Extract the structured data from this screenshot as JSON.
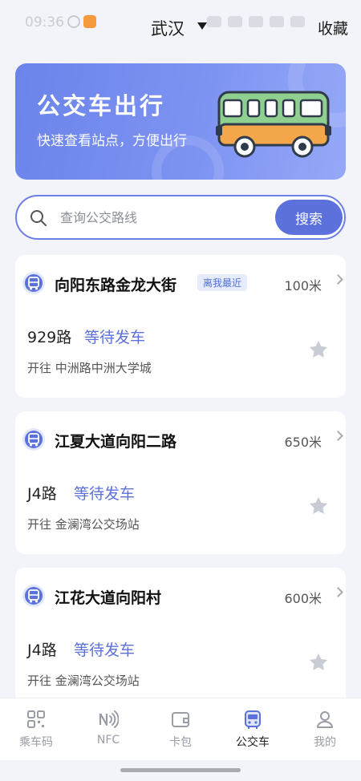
{
  "status_bar": {
    "time": "09:36"
  },
  "header": {
    "city": "武汉",
    "favorites_label": "收藏"
  },
  "banner": {
    "title": "公交车出行",
    "subtitle": "快速查看站点，方便出行"
  },
  "search": {
    "placeholder": "查询公交路线",
    "button_label": "搜索"
  },
  "stops": [
    {
      "name": "向阳东路金龙大街",
      "badge": "离我最近",
      "distance": "100米",
      "route": "929路",
      "status": "等待发车",
      "destination": "开往 中洲路中洲大学城"
    },
    {
      "name": "江夏大道向阳二路",
      "distance": "650米",
      "route": "J4路",
      "status": "等待发车",
      "destination": "开往 金澜湾公交场站"
    },
    {
      "name": "江花大道向阳村",
      "distance": "600米",
      "route": "J4路",
      "status": "等待发车",
      "destination": "开往 金澜湾公交场站"
    }
  ],
  "tabbar": {
    "items": [
      {
        "label": "乘车码",
        "icon": "qr-code-icon"
      },
      {
        "label": "NFC",
        "icon": "nfc-icon"
      },
      {
        "label": "卡包",
        "icon": "wallet-icon"
      },
      {
        "label": "公交车",
        "icon": "bus-icon"
      },
      {
        "label": "我的",
        "icon": "profile-icon"
      }
    ],
    "active": "公交车"
  },
  "colors": {
    "accent": "#5c71dc",
    "banner": "#7d93f2",
    "background": "#f3f4f9"
  }
}
